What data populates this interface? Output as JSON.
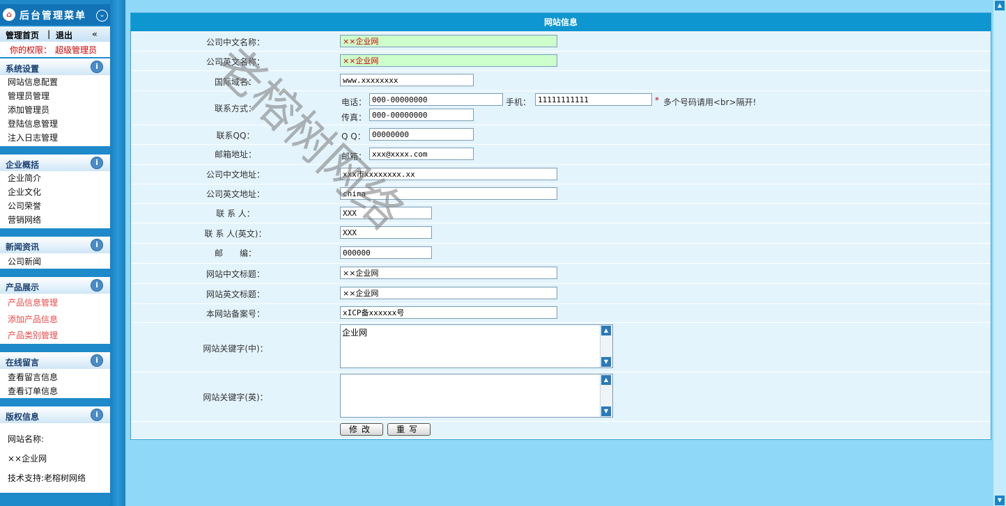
{
  "sidebar": {
    "menu_title": "后台管理菜单",
    "home": "管理首页",
    "separator": "|",
    "logout": "退出",
    "perm_label": "你的权限：",
    "perm_value": "超级管理员",
    "sections": [
      {
        "title": "系统设置",
        "items": [
          "网站信息配置",
          "管理员管理",
          "添加管理员",
          "登陆信息管理",
          "注入日志管理"
        ]
      },
      {
        "title": "企业概括",
        "items": [
          "企业简介",
          "企业文化",
          "公司荣誉",
          "营销网络"
        ]
      },
      {
        "title": "新闻资讯",
        "items": [
          "公司新闻"
        ]
      },
      {
        "title": "产品展示",
        "items": [
          "产品信息管理",
          "添加产品信息",
          "产品类别管理"
        ]
      },
      {
        "title": "在线留言",
        "items": [
          "查看留言信息",
          "查看订单信息"
        ]
      },
      {
        "title": "版权信息",
        "items": [
          "网站名称:",
          "××企业网",
          "技术支持:老榕树网络"
        ]
      }
    ]
  },
  "panel": {
    "title": "网站信息",
    "labels": {
      "cn_name": "公司中文名称：",
      "en_name": "公司英文名称：",
      "domain": "国际域名：",
      "contact": "联系方式：",
      "qq": "联系QQ：",
      "email": "邮箱地址：",
      "cn_addr": "公司中文地址：",
      "en_addr": "公司英文地址：",
      "person": "联 系 人：",
      "person_en": "联 系 人(英文)：",
      "zip": "邮　　编：",
      "cn_title": "网站中文标题：",
      "en_title": "网站英文标题：",
      "icp": "本网站备案号：",
      "kw_cn": "网站关键字(中)：",
      "kw_en": "网站关键字(英)："
    },
    "inline": {
      "tel": "电话：",
      "mobile": "手机：",
      "fax": "传真：",
      "qq": "Q Q：",
      "email": "邮箱：",
      "hint": "多个号码请用<br>隔开!",
      "star": "*"
    },
    "values": {
      "cn_name": "××企业网",
      "en_name": "××企业网",
      "domain": "www.xxxxxxxx",
      "tel": "000-00000000",
      "mobile": "11111111111",
      "fax": "000-00000000",
      "qq": "00000000",
      "email": "xxx@xxxx.com",
      "cn_addr": "xxx市xxxxxxxx.xx",
      "en_addr": "china",
      "person": "XXX",
      "person_en": "XXX",
      "zip": "000000",
      "cn_title": "××企业网",
      "en_title": "××企业网",
      "icp": "xICP备xxxxxx号",
      "kw_cn": "企业网",
      "kw_en": ""
    },
    "buttons": {
      "submit": "修改",
      "reset": "重写"
    }
  },
  "watermark": "老榕树网络",
  "colors": {
    "panel_header": "#0d96cf",
    "row_bg": "#e4f4fd",
    "sidebar": "#1e8ac9",
    "highlight_input": "#ccffcc"
  }
}
